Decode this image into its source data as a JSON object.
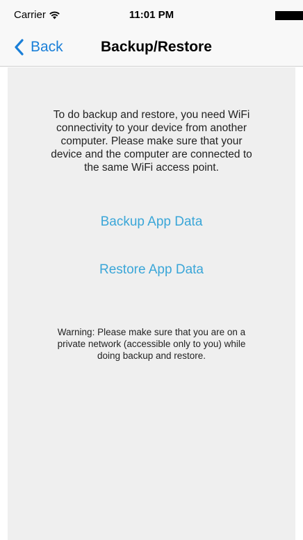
{
  "status_bar": {
    "carrier": "Carrier",
    "time": "11:01 PM",
    "wifi_icon": "wifi-icon",
    "battery_icon": "battery-icon"
  },
  "nav_bar": {
    "back_label": "Back",
    "back_icon": "chevron-left-icon",
    "title": "Backup/Restore",
    "accent_color": "#1a7fd8"
  },
  "content": {
    "info_text": "To do backup and restore, you need WiFi\nconnectivity to your device from another\ncomputer. Please make sure that your\ndevice and the computer are connected to\nthe same WiFi access point.",
    "backup_label": "Backup App Data",
    "restore_label": "Restore App Data",
    "link_color": "#3aa6d8",
    "warning_text": "Warning: Please make sure that you are on a\nprivate network (accessible only to you) while\ndoing backup and restore."
  }
}
